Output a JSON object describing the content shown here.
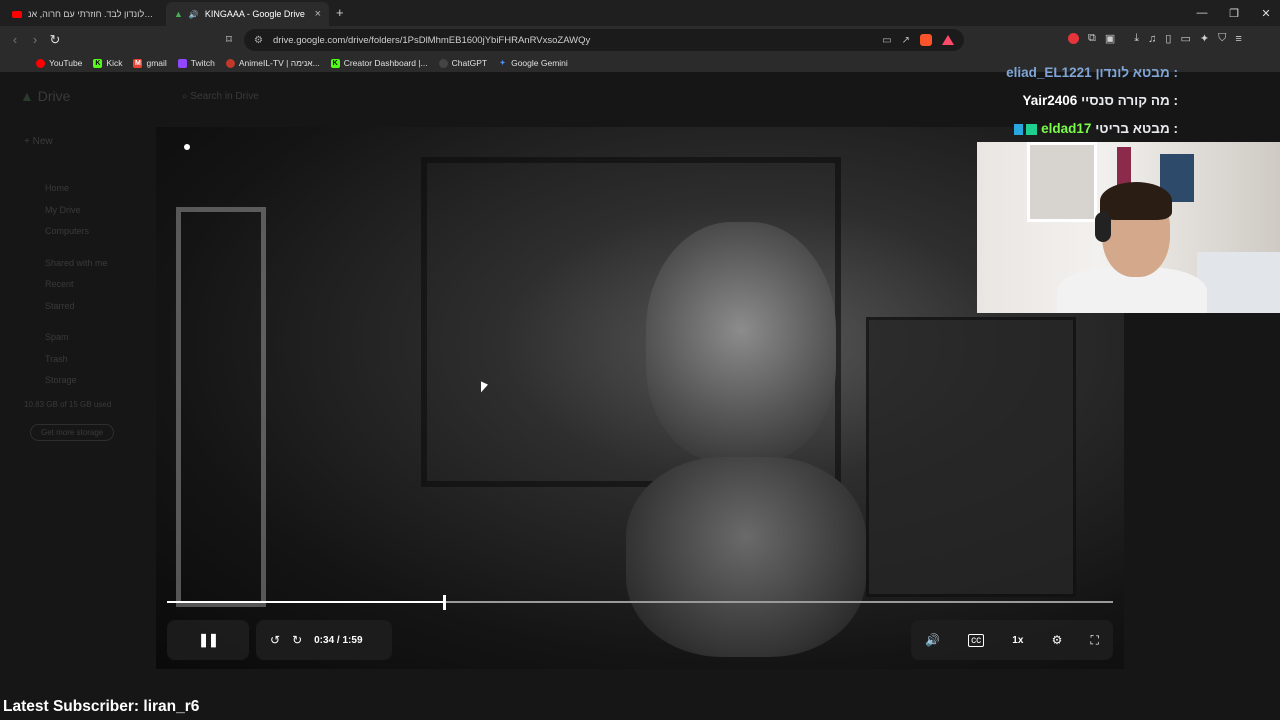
{
  "browser": {
    "tabs": [
      {
        "title": "סטטי ללונדון לבד. חוזרתי עם חרוה, אנ",
        "active": false
      },
      {
        "title": "KINGAAA - Google Drive",
        "active": true
      }
    ],
    "new_tab": "+",
    "window_controls": {
      "minimize": "—",
      "restore": "❐",
      "close": "✕"
    },
    "url": "drive.google.com/drive/folders/1PsDlMhmEB1600jYbiFHRAnRVxsoZAWQy",
    "bookmarks": [
      {
        "label": "YouTube",
        "color": "#ff0000"
      },
      {
        "label": "Kick",
        "color": "#53fc18"
      },
      {
        "label": "gmail",
        "color": "#ea4335"
      },
      {
        "label": "Twitch",
        "color": "#9146ff"
      },
      {
        "label": "AnimeIL-TV | אנימה...",
        "color": "#c0392b"
      },
      {
        "label": "Creator Dashboard |...",
        "color": "#53fc18"
      },
      {
        "label": "ChatGPT",
        "color": "#10a37f"
      },
      {
        "label": "Google Gemini",
        "color": "#4e8ff8"
      }
    ]
  },
  "drive": {
    "logo": "Drive",
    "search_placeholder": "Search in Drive",
    "new_button": "New",
    "nav": [
      "Home",
      "My Drive",
      "Computers",
      "Shared with me",
      "Recent",
      "Starred",
      "Spam",
      "Trash",
      "Storage"
    ],
    "storage_text": "10.83 GB of 15 GB used",
    "storage_button": "Get more storage"
  },
  "player": {
    "progress_fraction": 0.293,
    "current_time": "0:34",
    "separator": "/",
    "duration": "1:59",
    "speed": "1x"
  },
  "stream_overlay": {
    "chat": [
      {
        "user": "eliad_EL1221",
        "message": "מבטא לונדון :",
        "user_color": "#7fa6d6"
      },
      {
        "user": "Yair2406",
        "message": "מה קורה סנסיי :",
        "user_color": "#ffffff"
      },
      {
        "user": "eldad17",
        "message": "מבטא בריטי :",
        "user_color": "#7cfc4a"
      }
    ],
    "latest_subscriber": "Latest Subscriber: liran_r6"
  }
}
